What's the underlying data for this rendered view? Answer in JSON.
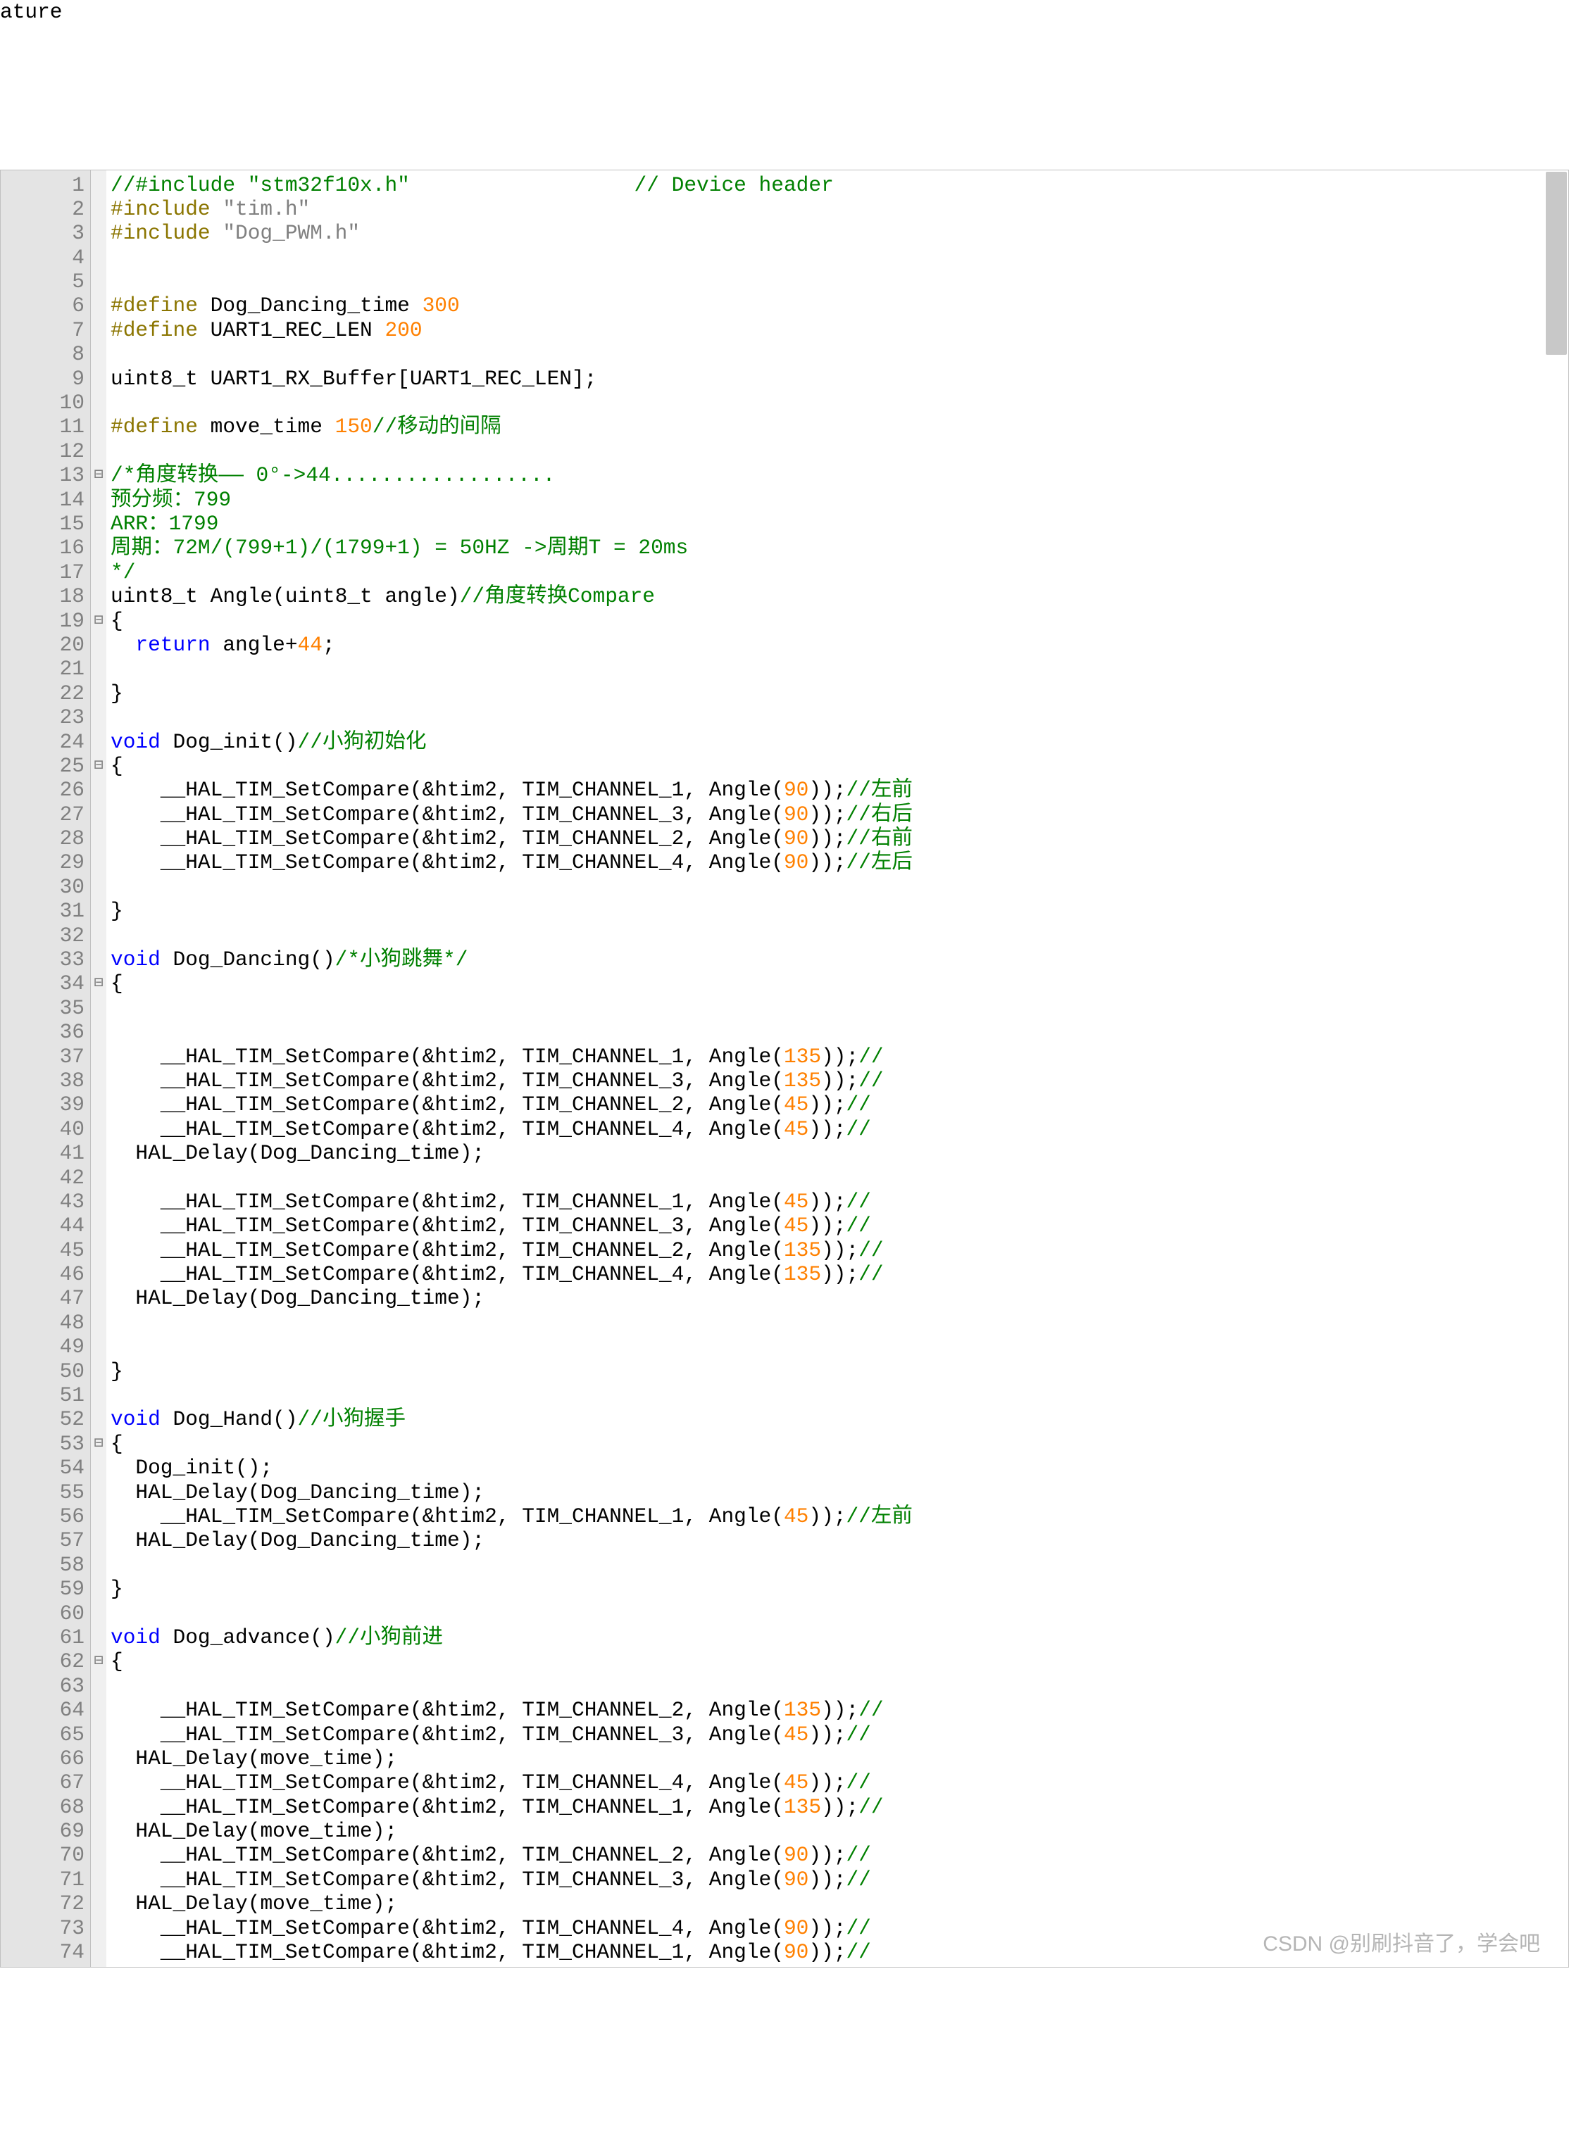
{
  "watermark": "CSDN @别刷抖音了，学会吧",
  "line_numbers": [
    "1",
    "2",
    "3",
    "4",
    "5",
    "6",
    "7",
    "8",
    "9",
    "10",
    "11",
    "12",
    "13",
    "14",
    "15",
    "16",
    "17",
    "18",
    "19",
    "20",
    "21",
    "22",
    "23",
    "24",
    "25",
    "26",
    "27",
    "28",
    "29",
    "30",
    "31",
    "32",
    "33",
    "34",
    "35",
    "36",
    "37",
    "38",
    "39",
    "40",
    "41",
    "42",
    "43",
    "44",
    "45",
    "46",
    "47",
    "48",
    "49",
    "50",
    "51",
    "52",
    "53",
    "54",
    "55",
    "56",
    "57",
    "58",
    "59",
    "60",
    "61",
    "62",
    "63",
    "64",
    "65",
    "66",
    "67",
    "68",
    "69",
    "70",
    "71",
    "72",
    "73",
    "74"
  ],
  "fold_marks": [
    "",
    "",
    "",
    "",
    "",
    "",
    "",
    "",
    "",
    "",
    "",
    "",
    "⊟",
    "",
    "",
    "",
    "",
    "",
    "⊟",
    "",
    "",
    "",
    "",
    "",
    "⊟",
    "",
    "",
    "",
    "",
    "",
    "",
    "",
    "",
    "⊟",
    "",
    "",
    "",
    "",
    "",
    "",
    "",
    "",
    "",
    "",
    "",
    "",
    "",
    "",
    "",
    "",
    "",
    "",
    "⊟",
    "",
    "",
    "",
    "",
    "",
    "",
    "",
    "",
    "⊟",
    "",
    "",
    "",
    "",
    "",
    "",
    "",
    "",
    "",
    "",
    "",
    ""
  ],
  "code": {
    "l1": {
      "a": "//#include \"stm32f10x.h\"",
      "b": "                  // Device header"
    },
    "l2": {
      "a": "#include ",
      "b": "\"tim.h\""
    },
    "l3": {
      "a": "#include ",
      "b": "\"Dog_PWM.h\""
    },
    "l4": "",
    "l5": "",
    "l6": {
      "a": "#define ",
      "b": "Dog_Dancing_time ",
      "c": "300"
    },
    "l7": {
      "a": "#define ",
      "b": "UART1_REC_LEN ",
      "c": "200"
    },
    "l8": "",
    "l9": {
      "a": "uint8_t UART1_RX_Buffer",
      "b": "[",
      "c": "UART1_REC_LEN",
      "d": "];"
    },
    "l10": "",
    "l11": {
      "a": "#define ",
      "b": "move_time ",
      "c": "150",
      "d": "//移动的间隔"
    },
    "l12": "",
    "l13": {
      "a": "/*角度转换—— 0°->44.................."
    },
    "l14": {
      "a": "预分频：799"
    },
    "l15": {
      "a": "ARR：1799"
    },
    "l16": {
      "a": "周期：72M/(799+1)/(1799+1) = 50HZ ->周期T = 20ms"
    },
    "l17": {
      "a": "*/"
    },
    "l18": {
      "a": "uint8_t Angle",
      "b": "(",
      "c": "uint8_t angle",
      "d": ")",
      "e": "//角度转换Compare"
    },
    "l19": {
      "a": "{"
    },
    "l20": {
      "a": "  ",
      "b": "return ",
      "c": "angle",
      "d": "+",
      "e": "44",
      "f": ";"
    },
    "l21": "",
    "l22": {
      "a": "}"
    },
    "l23": "",
    "l24": {
      "a": "void ",
      "b": "Dog_init",
      "c": "()",
      "d": "//小狗初始化"
    },
    "l25": {
      "a": "{"
    },
    "l26": {
      "a": "    __HAL_TIM_SetCompare",
      "b": "(&",
      "c": "htim2",
      "d": ", ",
      "e": "TIM_CHANNEL_1",
      "f": ", ",
      "g": "Angle",
      "h": "(",
      "i": "90",
      "j": "));",
      "k": "//左前"
    },
    "l27": {
      "a": "    __HAL_TIM_SetCompare",
      "b": "(&",
      "c": "htim2",
      "d": ", ",
      "e": "TIM_CHANNEL_3",
      "f": ", ",
      "g": "Angle",
      "h": "(",
      "i": "90",
      "j": "));",
      "k": "//右后"
    },
    "l28": {
      "a": "    __HAL_TIM_SetCompare",
      "b": "(&",
      "c": "htim2",
      "d": ", ",
      "e": "TIM_CHANNEL_2",
      "f": ", ",
      "g": "Angle",
      "h": "(",
      "i": "90",
      "j": "));",
      "k": "//右前"
    },
    "l29": {
      "a": "    __HAL_TIM_SetCompare",
      "b": "(&",
      "c": "htim2",
      "d": ", ",
      "e": "TIM_CHANNEL_4",
      "f": ", ",
      "g": "Angle",
      "h": "(",
      "i": "90",
      "j": "));",
      "k": "//左后"
    },
    "l30": "",
    "l31": {
      "a": "}"
    },
    "l32": "",
    "l33": {
      "a": "void ",
      "b": "Dog_Dancing",
      "c": "()",
      "d": "/*小狗跳舞*/"
    },
    "l34": {
      "a": "{"
    },
    "l35": "",
    "l36": "",
    "l37": {
      "a": "    __HAL_TIM_SetCompare",
      "b": "(&",
      "c": "htim2",
      "d": ", ",
      "e": "TIM_CHANNEL_1",
      "f": ", ",
      "g": "Angle",
      "h": "(",
      "i": "135",
      "j": "));",
      "k": "//"
    },
    "l38": {
      "a": "    __HAL_TIM_SetCompare",
      "b": "(&",
      "c": "htim2",
      "d": ", ",
      "e": "TIM_CHANNEL_3",
      "f": ", ",
      "g": "Angle",
      "h": "(",
      "i": "135",
      "j": "));",
      "k": "//"
    },
    "l39": {
      "a": "    __HAL_TIM_SetCompare",
      "b": "(&",
      "c": "htim2",
      "d": ", ",
      "e": "TIM_CHANNEL_2",
      "f": ", ",
      "g": "Angle",
      "h": "(",
      "i": "45",
      "j": "));",
      "k": "//"
    },
    "l40": {
      "a": "    __HAL_TIM_SetCompare",
      "b": "(&",
      "c": "htim2",
      "d": ", ",
      "e": "TIM_CHANNEL_4",
      "f": ", ",
      "g": "Angle",
      "h": "(",
      "i": "45",
      "j": "));",
      "k": "//"
    },
    "l41": {
      "a": "  HAL_Delay",
      "b": "(",
      "c": "Dog_Dancing_time",
      "d": ");"
    },
    "l42": "",
    "l43": {
      "a": "    __HAL_TIM_SetCompare",
      "b": "(&",
      "c": "htim2",
      "d": ", ",
      "e": "TIM_CHANNEL_1",
      "f": ", ",
      "g": "Angle",
      "h": "(",
      "i": "45",
      "j": "));",
      "k": "//"
    },
    "l44": {
      "a": "    __HAL_TIM_SetCompare",
      "b": "(&",
      "c": "htim2",
      "d": ", ",
      "e": "TIM_CHANNEL_3",
      "f": ", ",
      "g": "Angle",
      "h": "(",
      "i": "45",
      "j": "));",
      "k": "//"
    },
    "l45": {
      "a": "    __HAL_TIM_SetCompare",
      "b": "(&",
      "c": "htim2",
      "d": ", ",
      "e": "TIM_CHANNEL_2",
      "f": ", ",
      "g": "Angle",
      "h": "(",
      "i": "135",
      "j": "));",
      "k": "//"
    },
    "l46": {
      "a": "    __HAL_TIM_SetCompare",
      "b": "(&",
      "c": "htim2",
      "d": ", ",
      "e": "TIM_CHANNEL_4",
      "f": ", ",
      "g": "Angle",
      "h": "(",
      "i": "135",
      "j": "));",
      "k": "//"
    },
    "l47": {
      "a": "  HAL_Delay",
      "b": "(",
      "c": "Dog_Dancing_time",
      "d": ");"
    },
    "l48": "",
    "l49": "",
    "l50": {
      "a": "}"
    },
    "l51": "",
    "l52": {
      "a": "void ",
      "b": "Dog_Hand",
      "c": "()",
      "d": "//小狗握手"
    },
    "l53": {
      "a": "{"
    },
    "l54": {
      "a": "  Dog_init",
      "b": "();"
    },
    "l55": {
      "a": "  HAL_Delay",
      "b": "(",
      "c": "Dog_Dancing_time",
      "d": ");"
    },
    "l56": {
      "a": "    __HAL_TIM_SetCompare",
      "b": "(&",
      "c": "htim2",
      "d": ", ",
      "e": "TIM_CHANNEL_1",
      "f": ", ",
      "g": "Angle",
      "h": "(",
      "i": "45",
      "j": "));",
      "k": "//左前"
    },
    "l57": {
      "a": "  HAL_Delay",
      "b": "(",
      "c": "Dog_Dancing_time",
      "d": ");"
    },
    "l58": "",
    "l59": {
      "a": "}"
    },
    "l60": "",
    "l61": {
      "a": "void ",
      "b": "Dog_advance",
      "c": "()",
      "d": "//小狗前进"
    },
    "l62": {
      "a": "{"
    },
    "l63": "",
    "l64": {
      "a": "    __HAL_TIM_SetCompare",
      "b": "(&",
      "c": "htim2",
      "d": ", ",
      "e": "TIM_CHANNEL_2",
      "f": ", ",
      "g": "Angle",
      "h": "(",
      "i": "135",
      "j": "));",
      "k": "//"
    },
    "l65": {
      "a": "    __HAL_TIM_SetCompare",
      "b": "(&",
      "c": "htim2",
      "d": ", ",
      "e": "TIM_CHANNEL_3",
      "f": ", ",
      "g": "Angle",
      "h": "(",
      "i": "45",
      "j": "));",
      "k": "//"
    },
    "l66": {
      "a": "  HAL_Delay",
      "b": "(",
      "c": "move_time",
      "d": ");"
    },
    "l67": {
      "a": "    __HAL_TIM_SetCompare",
      "b": "(&",
      "c": "htim2",
      "d": ", ",
      "e": "TIM_CHANNEL_4",
      "f": ", ",
      "g": "Angle",
      "h": "(",
      "i": "45",
      "j": "));",
      "k": "//"
    },
    "l68": {
      "a": "    __HAL_TIM_SetCompare",
      "b": "(&",
      "c": "htim2",
      "d": ", ",
      "e": "TIM_CHANNEL_1",
      "f": ", ",
      "g": "Angle",
      "h": "(",
      "i": "135",
      "j": "));",
      "k": "//"
    },
    "l69": {
      "a": "  HAL_Delay",
      "b": "(",
      "c": "move_time",
      "d": ");"
    },
    "l70": {
      "a": "    __HAL_TIM_SetCompare",
      "b": "(&",
      "c": "htim2",
      "d": ", ",
      "e": "TIM_CHANNEL_2",
      "f": ", ",
      "g": "Angle",
      "h": "(",
      "i": "90",
      "j": "));",
      "k": "//"
    },
    "l71": {
      "a": "    __HAL_TIM_SetCompare",
      "b": "(&",
      "c": "htim2",
      "d": ", ",
      "e": "TIM_CHANNEL_3",
      "f": ", ",
      "g": "Angle",
      "h": "(",
      "i": "90",
      "j": "));",
      "k": "//"
    },
    "l72": {
      "a": "  HAL_Delay",
      "b": "(",
      "c": "move_time",
      "d": ");"
    },
    "l73": {
      "a": "    __HAL_TIM_SetCompare",
      "b": "(&",
      "c": "htim2",
      "d": ", ",
      "e": "TIM_CHANNEL_4",
      "f": ", ",
      "g": "Angle",
      "h": "(",
      "i": "90",
      "j": "));",
      "k": "//"
    },
    "l74": {
      "a": "    __HAL_TIM_SetCompare",
      "b": "(&",
      "c": "htim2",
      "d": ", ",
      "e": "TIM_CHANNEL_1",
      "f": ", ",
      "g": "Angle",
      "h": "(",
      "i": "90",
      "j": "));",
      "k": "//"
    }
  }
}
